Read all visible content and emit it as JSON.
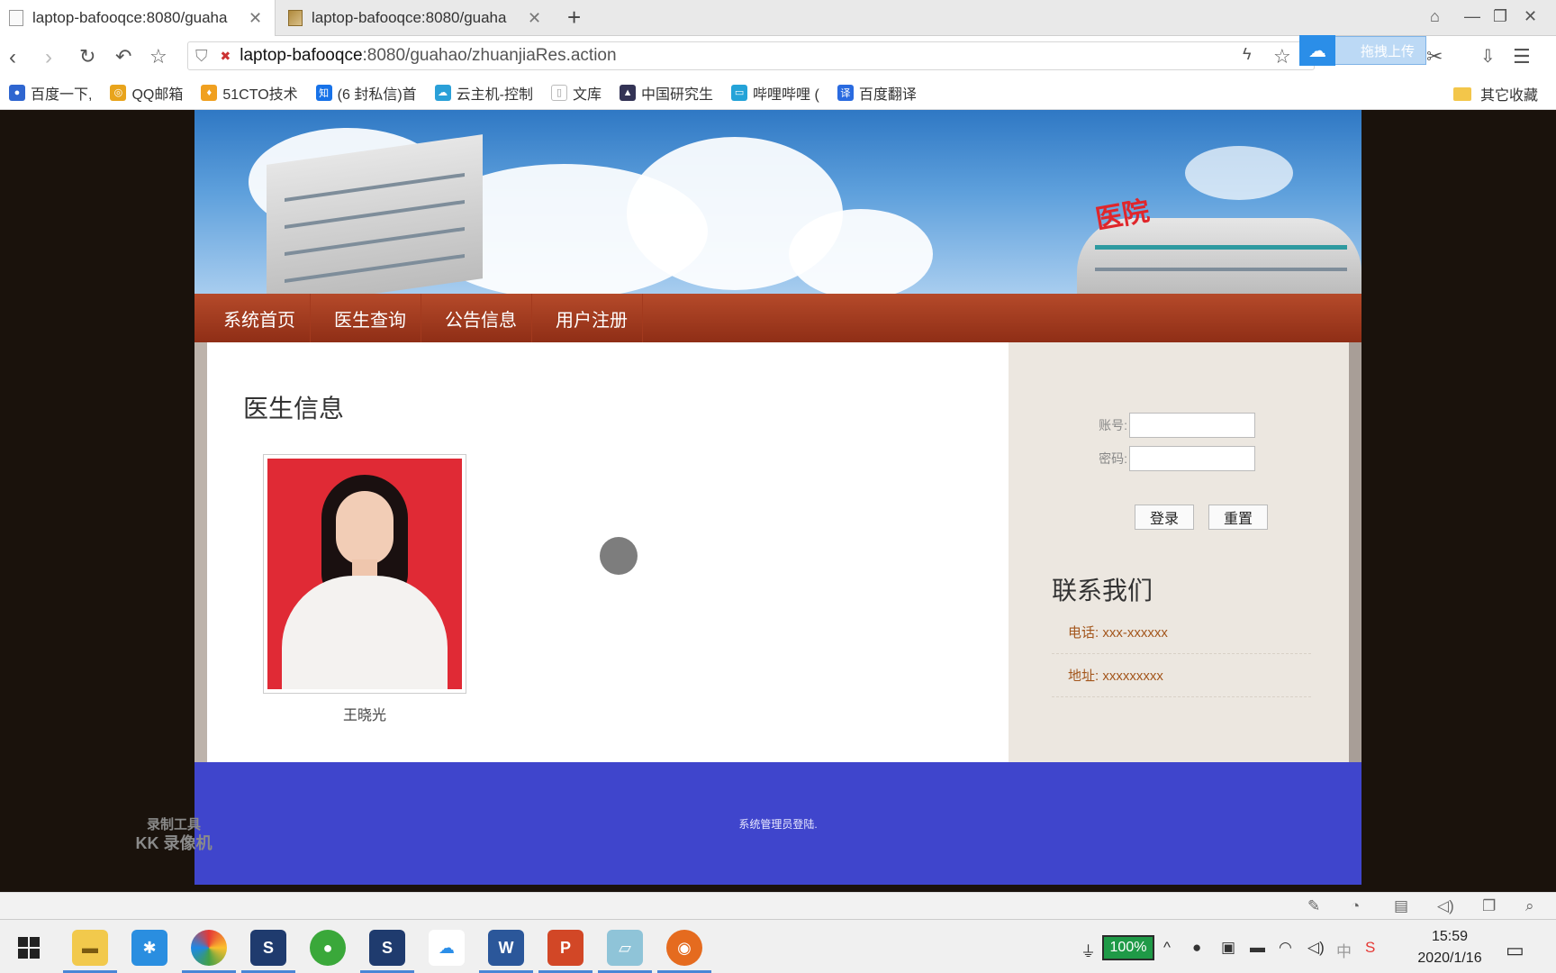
{
  "browser": {
    "tabs": [
      {
        "title": "laptop-bafooqce:8080/guaha",
        "active": true
      },
      {
        "title": "laptop-bafooqce:8080/guaha",
        "active": false
      }
    ],
    "url_host": "laptop-bafooqce",
    "url_path": ":8080/guahao/zhuanjiaRes.action",
    "upload_label": "拖拽上传",
    "bookmarks": [
      {
        "label": "百度一下,",
        "icon": "paw-icon",
        "color": "#2f66d0"
      },
      {
        "label": "QQ邮箱",
        "icon": "qq-mail-icon",
        "color": "#e8a41c"
      },
      {
        "label": "51CTO技术",
        "icon": "flame-icon",
        "color": "#f0a020"
      },
      {
        "label": "(6 封私信)首",
        "icon": "zhihu-icon",
        "color": "#1772e8"
      },
      {
        "label": "云主机-控制",
        "icon": "cloud-icon",
        "color": "#2aa0d8"
      },
      {
        "label": "文库",
        "icon": "page-icon",
        "color": "#bbbbbb"
      },
      {
        "label": "中国研究生",
        "icon": "grad-cap-icon",
        "color": "#333355"
      },
      {
        "label": "哔哩哔哩 (",
        "icon": "tv-icon",
        "color": "#24a3d8"
      },
      {
        "label": "百度翻译",
        "icon": "translate-icon",
        "color": "#2a6be0"
      }
    ],
    "other_bookmarks": "其它收藏"
  },
  "site": {
    "nav": [
      "系统首页",
      "医生查询",
      "公告信息",
      "用户注册"
    ],
    "main": {
      "heading": "医生信息",
      "doctor_name": "王晓光"
    },
    "login": {
      "account_label": "账号:",
      "password_label": "密码:",
      "login_button": "登录",
      "reset_button": "重置"
    },
    "contact": {
      "heading": "联系我们",
      "phone": "电话: xxx-xxxxxx",
      "address": "地址: xxxxxxxxx"
    },
    "footer": "系统管理员登陆."
  },
  "watermark": {
    "line1": "录制工具",
    "line2": "KK 录像机"
  },
  "taskbar": {
    "battery": "100%",
    "time": "15:59",
    "date": "2020/1/16",
    "ime": "中"
  },
  "colors": {
    "nav_bg": "#9c3820",
    "footer_bg": "#3f45cc",
    "contact_text": "#a3561c",
    "battery": "#1f9a47"
  }
}
